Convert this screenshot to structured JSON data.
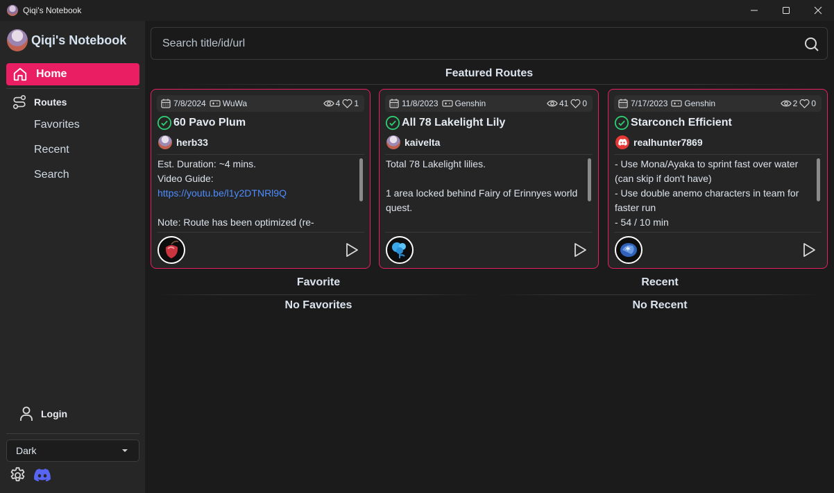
{
  "window": {
    "title": "Qiqi's Notebook"
  },
  "sidebar": {
    "brand": "Qiqi's Notebook",
    "home": "Home",
    "routes": "Routes",
    "sub_items": [
      "Favorites",
      "Recent",
      "Search"
    ],
    "login": "Login",
    "theme": {
      "selected": "Dark"
    }
  },
  "search": {
    "placeholder": "Search title/id/url",
    "value": ""
  },
  "featured": {
    "title": "Featured Routes",
    "cards": [
      {
        "date": "7/8/2024",
        "game": "WuWa",
        "views": "4",
        "likes": "1",
        "title": "60 Pavo Plum",
        "verified": true,
        "author": "herb33",
        "author_avatar": "qiqi-avatar",
        "description_lines": [
          "Est. Duration: ~4 mins.",
          "Video Guide:"
        ],
        "link": "https://youtu.be/l1y2DTNRl9Q",
        "description_after": "\nNote: Route has been optimized (re-",
        "item_icon": "pavo-plum-icon"
      },
      {
        "date": "11/8/2023",
        "game": "Genshin",
        "views": "41",
        "likes": "0",
        "title": "All 78 Lakelight Lily",
        "verified": true,
        "author": "kaivelta",
        "author_avatar": "qiqi-avatar",
        "description": "Total 78 Lakelight lilies.\n\n1 area locked behind Fairy of Erinnyes world quest.",
        "item_icon": "lakelight-lily-icon"
      },
      {
        "date": "7/17/2023",
        "game": "Genshin",
        "views": "2",
        "likes": "0",
        "title": "Starconch Efficient",
        "verified": true,
        "author": "realhunter7869",
        "author_avatar": "discord-avatar",
        "description": "- Use Mona/Ayaka to sprint fast over water (can skip if don't have)\n- Use double anemo characters in team for faster run\n- 54 / 10 min",
        "item_icon": "starconch-icon"
      }
    ]
  },
  "favorite": {
    "title": "Favorite",
    "empty": "No Favorites"
  },
  "recent": {
    "title": "Recent",
    "empty": "No Recent"
  },
  "colors": {
    "accent": "#e91e63",
    "verified": "#2ecc71",
    "link": "#4e8cff",
    "discord": "#5865f2"
  }
}
